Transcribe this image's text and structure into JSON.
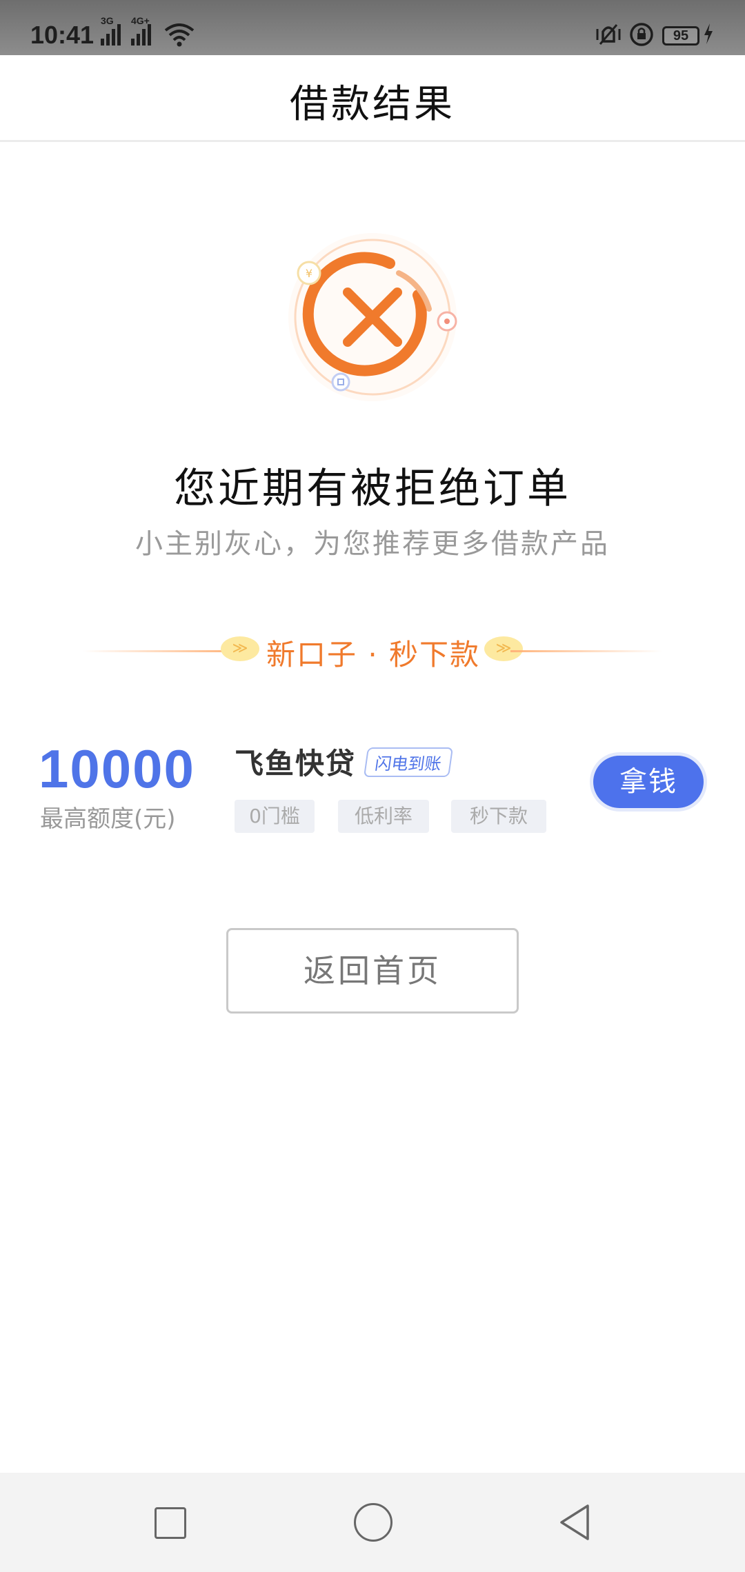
{
  "status_bar": {
    "time": "10:41",
    "signal1_label": "3G",
    "signal2_label": "4G+",
    "battery": "95"
  },
  "header": {
    "title": "借款结果"
  },
  "result": {
    "title": "您近期有被拒绝订单",
    "subtitle": "小主别灰心，为您推荐更多借款产品"
  },
  "section": {
    "label": "新口子 · 秒下款"
  },
  "product": {
    "amount": "10000",
    "amount_label": "最高额度(元)",
    "name": "飞鱼快贷",
    "badge": "闪电到账",
    "tags": [
      "0门槛",
      "低利率",
      "秒下款"
    ],
    "action_label": "拿钱"
  },
  "home_button": {
    "label": "返回首页"
  },
  "colors": {
    "accent": "#4f74e8",
    "orange": "#f07a2c"
  },
  "icons": {
    "result": "reject-x-icon",
    "nav_recent": "square-icon",
    "nav_home": "circle-icon",
    "nav_back": "triangle-back-icon"
  }
}
